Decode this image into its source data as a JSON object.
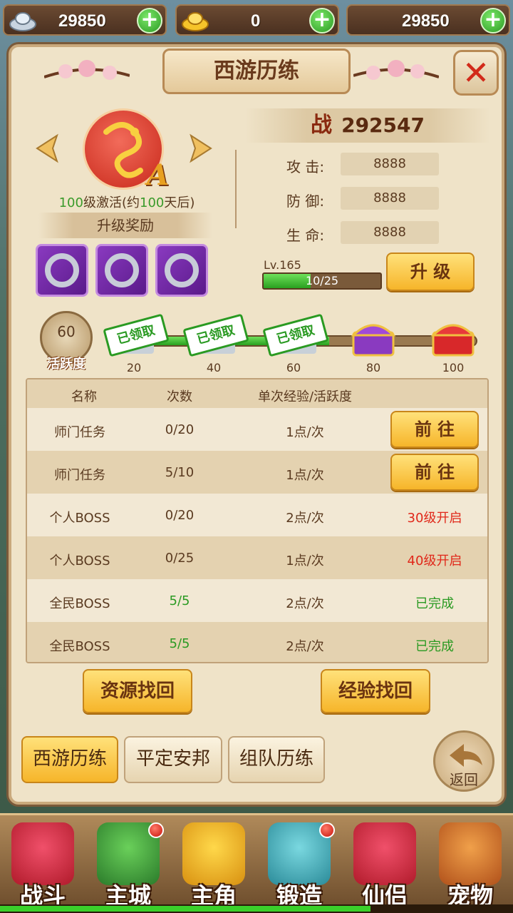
{
  "resources": [
    {
      "icon": "silver-ingot-icon",
      "value": "29850"
    },
    {
      "icon": "gold-ingot-icon",
      "value": "0"
    },
    {
      "icon": "",
      "value": "29850"
    }
  ],
  "title": "西游历练",
  "emblem": {
    "grade": "A",
    "activate_prefix": "",
    "activate_level": "100",
    "activate_mid": "级激活(约",
    "activate_days": "100",
    "activate_suffix": "天后)"
  },
  "reward_header": "升级奖励",
  "reward_items": [
    "bracelet-icon",
    "bracelet-icon",
    "bracelet-icon"
  ],
  "power": {
    "label": "战",
    "value": "292547"
  },
  "stats": [
    {
      "label": "攻  击:",
      "value": "8888"
    },
    {
      "label": "防  御:",
      "value": "8888"
    },
    {
      "label": "生  命:",
      "value": "8888"
    }
  ],
  "level": {
    "label": "Lv.165",
    "progress_text": "10/25",
    "current": 10,
    "max": 25
  },
  "upgrade_button": "升 级",
  "activity": {
    "value": "60",
    "label": "活跃度",
    "progress_fraction": 0.6,
    "chests": [
      {
        "threshold": "20",
        "claimed": true,
        "claimed_label": "已领取"
      },
      {
        "threshold": "40",
        "claimed": true,
        "claimed_label": "已领取"
      },
      {
        "threshold": "60",
        "claimed": true,
        "claimed_label": "已领取"
      },
      {
        "threshold": "80",
        "claimed": false
      },
      {
        "threshold": "100",
        "claimed": false
      }
    ]
  },
  "table": {
    "headers": [
      "名称",
      "次数",
      "单次经验/活跃度"
    ],
    "rows": [
      {
        "name": "师门任务",
        "count": "0/20",
        "exp": "1点/次",
        "action": "前 往",
        "action_type": "button"
      },
      {
        "name": "师门任务",
        "count": "5/10",
        "exp": "1点/次",
        "action": "前 往",
        "action_type": "button"
      },
      {
        "name": "个人BOSS",
        "count": "0/20",
        "exp": "2点/次",
        "action": "30级开启",
        "action_type": "locked"
      },
      {
        "name": "个人BOSS",
        "count": "0/25",
        "exp": "1点/次",
        "action": "40级开启",
        "action_type": "locked"
      },
      {
        "name": "全民BOSS",
        "count": "5/5",
        "exp": "2点/次",
        "action": "已完成",
        "action_type": "done"
      },
      {
        "name": "全民BOSS",
        "count": "5/5",
        "exp": "2点/次",
        "action": "已完成",
        "action_type": "done"
      }
    ]
  },
  "recover_buttons": [
    "资源找回",
    "经验找回"
  ],
  "tabs": [
    "西游历练",
    "平定安邦",
    "组队历练"
  ],
  "back_label": "返回",
  "nav": [
    {
      "label": "战斗",
      "icon": "battle-icon",
      "badge": false,
      "color": "#d8283a"
    },
    {
      "label": "主城",
      "icon": "city-icon",
      "badge": true,
      "color": "#3a9a3a"
    },
    {
      "label": "主角",
      "icon": "hero-icon",
      "badge": false,
      "color": "#f0b020"
    },
    {
      "label": "锻造",
      "icon": "forge-icon",
      "badge": true,
      "color": "#3aa0a8"
    },
    {
      "label": "仙侣",
      "icon": "partner-icon",
      "badge": false,
      "color": "#d8283a"
    },
    {
      "label": "宠物",
      "icon": "pet-icon",
      "badge": false,
      "color": "#e07a2a"
    }
  ]
}
